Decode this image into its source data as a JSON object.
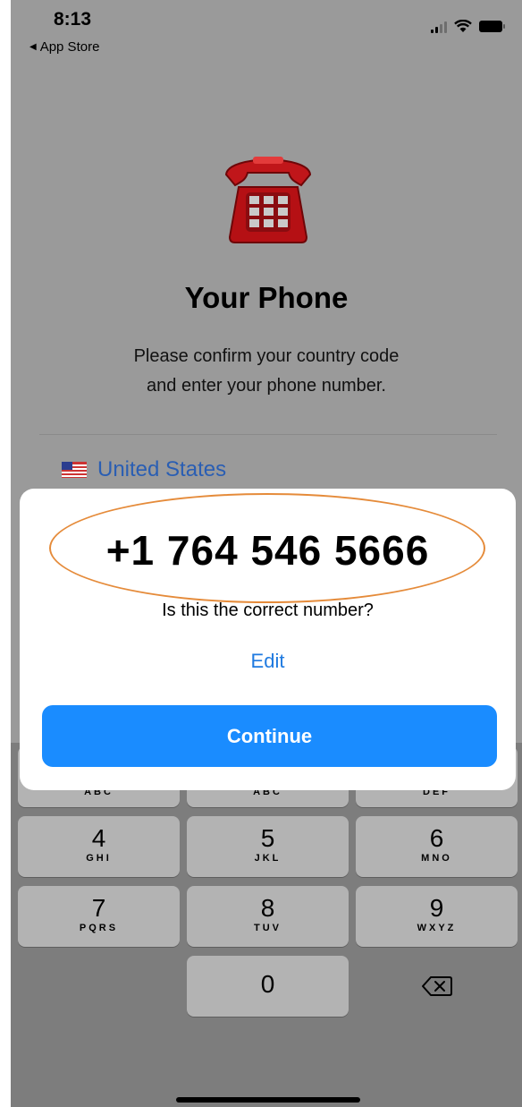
{
  "status_bar": {
    "time": "8:13",
    "back_label": "App Store"
  },
  "header": {
    "icon": "telephone-icon",
    "title": "Your Phone",
    "subtitle_line1": "Please confirm your country code",
    "subtitle_line2": "and enter your phone number."
  },
  "country": {
    "flag_icon": "us-flag-icon",
    "name": "United States"
  },
  "dialog": {
    "phone_number": "+1 764 546 5666",
    "question": "Is this the correct number?",
    "edit_label": "Edit",
    "continue_label": "Continue"
  },
  "keypad": {
    "keys": [
      {
        "digit": "",
        "letters": "ABC"
      },
      {
        "digit": "",
        "letters": "DEF"
      },
      {
        "digit": "4",
        "letters": "GHI"
      },
      {
        "digit": "5",
        "letters": "JKL"
      },
      {
        "digit": "6",
        "letters": "MNO"
      },
      {
        "digit": "7",
        "letters": "PQRS"
      },
      {
        "digit": "8",
        "letters": "TUV"
      },
      {
        "digit": "9",
        "letters": "WXYZ"
      },
      {
        "digit": "0",
        "letters": ""
      }
    ],
    "delete_icon": "backspace-icon"
  },
  "colors": {
    "accent": "#1a8cff",
    "link": "#1f7ae0",
    "highlight_ring": "#e58b3a",
    "country_text": "#2a5eb3"
  }
}
